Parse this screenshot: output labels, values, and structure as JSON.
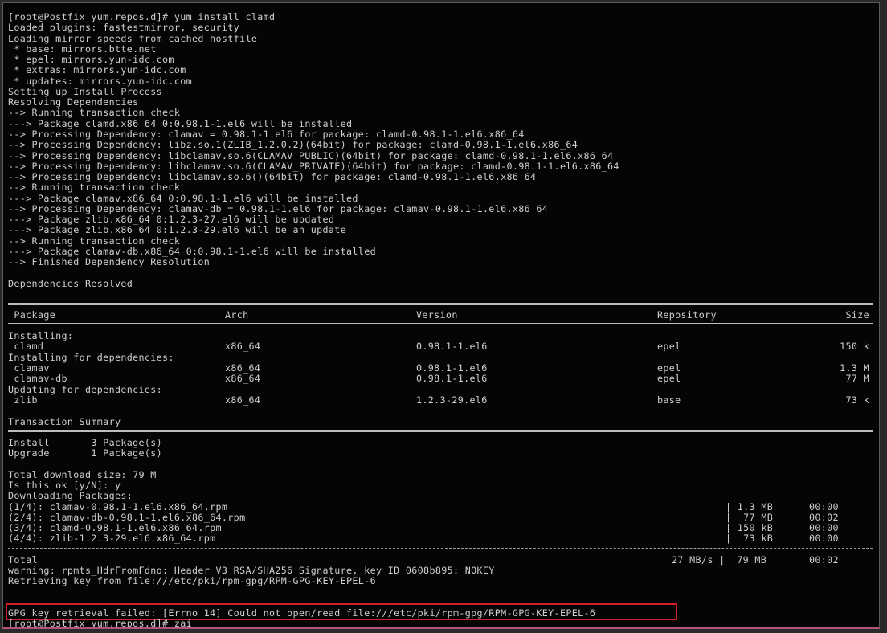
{
  "lines_top": [
    "[root@Postfix yum.repos.d]# yum install clamd",
    "Loaded plugins: fastestmirror, security",
    "Loading mirror speeds from cached hostfile",
    " * base: mirrors.btte.net",
    " * epel: mirrors.yun-idc.com",
    " * extras: mirrors.yun-idc.com",
    " * updates: mirrors.yun-idc.com",
    "Setting up Install Process",
    "Resolving Dependencies",
    "--> Running transaction check",
    "---> Package clamd.x86_64 0:0.98.1-1.el6 will be installed",
    "--> Processing Dependency: clamav = 0.98.1-1.el6 for package: clamd-0.98.1-1.el6.x86_64",
    "--> Processing Dependency: libz.so.1(ZLIB_1.2.0.2)(64bit) for package: clamd-0.98.1-1.el6.x86_64",
    "--> Processing Dependency: libclamav.so.6(CLAMAV_PUBLIC)(64bit) for package: clamd-0.98.1-1.el6.x86_64",
    "--> Processing Dependency: libclamav.so.6(CLAMAV_PRIVATE)(64bit) for package: clamd-0.98.1-1.el6.x86_64",
    "--> Processing Dependency: libclamav.so.6()(64bit) for package: clamd-0.98.1-1.el6.x86_64",
    "--> Running transaction check",
    "---> Package clamav.x86_64 0:0.98.1-1.el6 will be installed",
    "--> Processing Dependency: clamav-db = 0.98.1-1.el6 for package: clamav-0.98.1-1.el6.x86_64",
    "---> Package zlib.x86_64 0:1.2.3-27.el6 will be updated",
    "---> Package zlib.x86_64 0:1.2.3-29.el6 will be an update",
    "--> Running transaction check",
    "---> Package clamav-db.x86_64 0:0.98.1-1.el6 will be installed",
    "--> Finished Dependency Resolution",
    "",
    "Dependencies Resolved"
  ],
  "table": {
    "headers": {
      "package": " Package",
      "arch": "Arch",
      "version": "Version",
      "repository": "Repository",
      "size": "Size"
    },
    "section_installing": "Installing:",
    "section_deps": "Installing for dependencies:",
    "section_updating": "Updating for dependencies:",
    "rows": [
      {
        "name": " clamd",
        "arch": "x86_64",
        "version": "0.98.1-1.el6",
        "repo": "epel",
        "size": "150 k"
      },
      {
        "name": " clamav",
        "arch": "x86_64",
        "version": "0.98.1-1.el6",
        "repo": "epel",
        "size": "1.3 M"
      },
      {
        "name": " clamav-db",
        "arch": "x86_64",
        "version": "0.98.1-1.el6",
        "repo": "epel",
        "size": "77 M"
      },
      {
        "name": " zlib",
        "arch": "x86_64",
        "version": "1.2.3-29.el6",
        "repo": "base",
        "size": "73 k"
      }
    ]
  },
  "summary": {
    "title": "Transaction Summary",
    "install": "Install       3 Package(s)",
    "upgrade": "Upgrade       1 Package(s)"
  },
  "download": {
    "total_size": "Total download size: 79 M",
    "prompt": "Is this ok [y/N]: y",
    "heading": "Downloading Packages:",
    "rows": [
      {
        "file": "(1/4): clamav-0.98.1-1.el6.x86_64.rpm",
        "size": "| 1.3 MB",
        "time": "00:00"
      },
      {
        "file": "(2/4): clamav-db-0.98.1-1.el6.x86_64.rpm",
        "size": "|  77 MB",
        "time": "00:02"
      },
      {
        "file": "(3/4): clamd-0.98.1-1.el6.x86_64.rpm",
        "size": "| 150 kB",
        "time": "00:00"
      },
      {
        "file": "(4/4): zlib-1.2.3-29.el6.x86_64.rpm",
        "size": "|  73 kB",
        "time": "00:00"
      }
    ],
    "total_label": "Total",
    "total_rate": "27 MB/s |  79 MB",
    "total_time": "00:02"
  },
  "messages": {
    "warning": "warning: rpmts_HdrFromFdno: Header V3 RSA/SHA256 Signature, key ID 0608b895: NOKEY",
    "retrieving": "Retrieving key from file:///etc/pki/rpm-gpg/RPM-GPG-KEY-EPEL-6",
    "error": "GPG key retrieval failed: [Errno 14] Could not open/read file:///etc/pki/rpm-gpg/RPM-GPG-KEY-EPEL-6",
    "final_prompt": "[root@Postfix yum.repos.d]# zai"
  },
  "colors": {
    "background": "#050505",
    "text": "#cfcfcf",
    "highlight": "#d0202c"
  }
}
